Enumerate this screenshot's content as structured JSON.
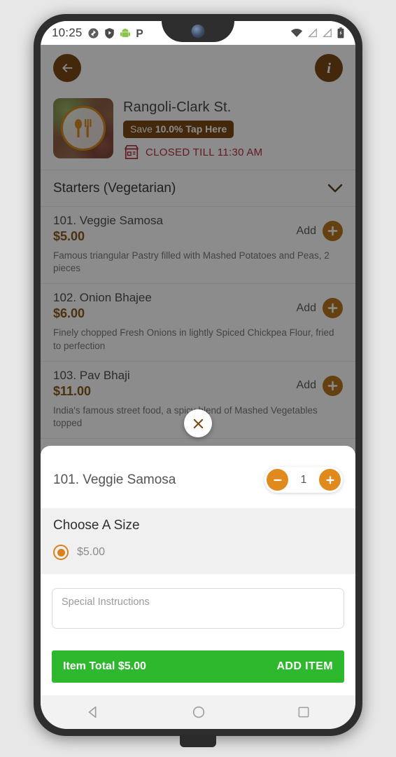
{
  "status_bar": {
    "clock": "10:25",
    "left_icons": [
      "sync-icon",
      "shield-icon",
      "android-icon",
      "p-app-icon"
    ],
    "right_icons": [
      "wifi-icon",
      "signal-off-icon",
      "signal-off-icon",
      "battery-icon"
    ]
  },
  "app_header": {
    "back_icon": "back-arrow-icon",
    "info_label": "i"
  },
  "restaurant": {
    "name": "Rangoli-Clark St.",
    "save_prefix": "Save ",
    "save_amount": "10.0%",
    "save_suffix": " Tap Here",
    "status": "CLOSED TILL 11:30 AM",
    "logo_icon": "plate-spoon-fork-icon",
    "store_icon": "storefront-icon"
  },
  "menu": {
    "section_title": "Starters (Vegetarian)",
    "collapse_icon": "chevron-down-icon",
    "add_label": "Add",
    "items": [
      {
        "name": "101. Veggie Samosa",
        "price": "$5.00",
        "description": "Famous triangular Pastry filled with Mashed Potatoes and Peas, 2 pieces"
      },
      {
        "name": "102. Onion Bhajee",
        "price": "$6.00",
        "description": "Finely chopped Fresh Onions in lightly Spiced Chickpea Flour, fried to perfection"
      },
      {
        "name": "103. Pav Bhaji",
        "price": "$11.00",
        "description": "India's famous street food, a spicy blend of Mashed Vegetables topped"
      }
    ]
  },
  "modal": {
    "close_icon": "close-icon",
    "item_name": "101. Veggie Samosa",
    "quantity": "1",
    "decrease_icon": "minus-icon",
    "increase_icon": "plus-icon",
    "size_title": "Choose A Size",
    "size_options": [
      {
        "price": "$5.00",
        "selected": true
      }
    ],
    "instructions_placeholder": "Special Instructions",
    "instructions_value": "",
    "item_total_label": "Item Total $5.00",
    "add_item_label": "ADD ITEM"
  },
  "nav_bar": {
    "back_icon": "nav-back-icon",
    "home_icon": "nav-home-icon",
    "recents_icon": "nav-recents-icon"
  },
  "colors": {
    "brand_brown": "#7a4a17",
    "accent_orange": "#e08a1e",
    "price_brown": "#8a5a1b",
    "closed_red": "#b5303c",
    "cta_green": "#2eb82e"
  }
}
